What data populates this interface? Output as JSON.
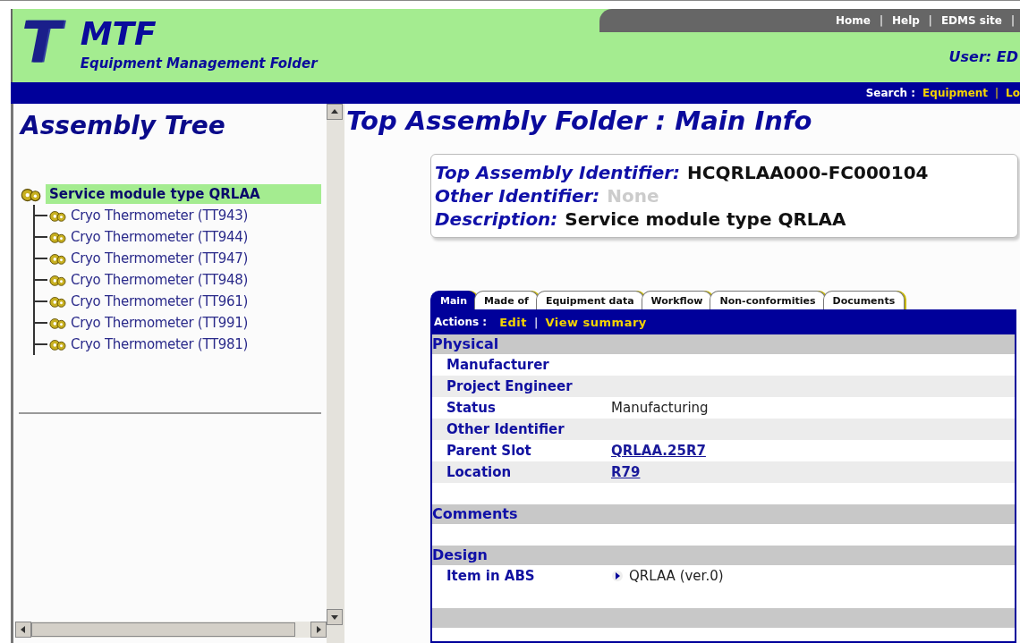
{
  "header": {
    "logo_letter": "T",
    "title": "MTF",
    "subtitle": "Equipment Management Folder",
    "links": [
      "Home",
      "Help",
      "EDMS site"
    ],
    "separator": "|",
    "user": "User: ED",
    "search_label": "Search :",
    "search_links": [
      "Equipment",
      "Lo"
    ]
  },
  "tree": {
    "title": "Assembly Tree",
    "root": {
      "label": "Service module type QRLAA",
      "selected": true,
      "children": [
        {
          "label": "Cryo Thermometer (TT943)",
          "selected": false
        },
        {
          "label": "Cryo Thermometer (TT944)",
          "selected": false
        },
        {
          "label": "Cryo Thermometer (TT947)",
          "selected": false
        },
        {
          "label": "Cryo Thermometer (TT948)",
          "selected": false
        },
        {
          "label": "Cryo Thermometer (TT961)",
          "selected": false
        },
        {
          "label": "Cryo Thermometer (TT991)",
          "selected": false
        },
        {
          "label": "Cryo Thermometer (TT981)",
          "selected": false
        }
      ]
    }
  },
  "main": {
    "title": "Top Assembly Folder : Main Info",
    "summary": [
      {
        "label": "Top Assembly Identifier:",
        "value": "HCQRLAA000-FC000104",
        "muted": false
      },
      {
        "label": "Other Identifier:",
        "value": "None",
        "muted": true
      },
      {
        "label": "Description:",
        "value": "Service module type QRLAA",
        "muted": false
      }
    ],
    "tabs": [
      {
        "label": "Main",
        "selected": true
      },
      {
        "label": "Made of",
        "selected": false
      },
      {
        "label": "Equipment data",
        "selected": false
      },
      {
        "label": "Workflow",
        "selected": false
      },
      {
        "label": "Non-conformities",
        "selected": false
      },
      {
        "label": "Documents",
        "selected": false
      }
    ],
    "actions": {
      "label": "Actions :",
      "links": [
        "Edit",
        "View summary"
      ]
    },
    "sections": [
      {
        "title": "Physical",
        "rows": [
          {
            "label": "Manufacturer",
            "kind": "text"
          },
          {
            "label": "Project Engineer",
            "kind": "text"
          },
          {
            "label": "Status",
            "value": "Manufacturing",
            "kind": "text"
          },
          {
            "label": "Other Identifier",
            "kind": "text"
          },
          {
            "label": "Parent Slot",
            "value": "QRLAA.25R7",
            "kind": "link"
          },
          {
            "label": "Location",
            "value": "R79",
            "kind": "link"
          }
        ]
      },
      {
        "title": "Comments"
      },
      {
        "title": "Design",
        "rows": [
          {
            "label": "Item in ABS",
            "value": "QRLAA (ver.0)",
            "kind": "arrow"
          }
        ]
      }
    ]
  }
}
